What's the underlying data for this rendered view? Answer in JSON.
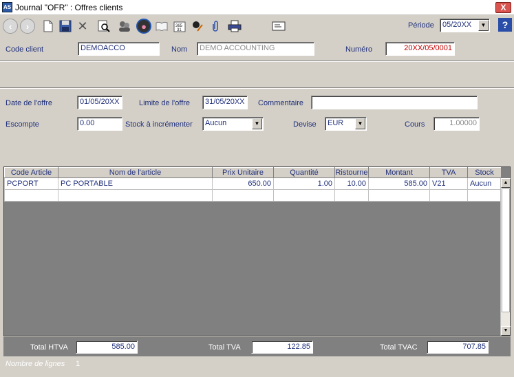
{
  "window": {
    "app_icon": "AS",
    "title": "Journal \"OFR\" : Offres clients",
    "close_label": "X"
  },
  "toolbar": {
    "periode_label": "Période",
    "periode_value": "05/20XX",
    "help_label": "?",
    "icons": [
      "back-icon",
      "forward-icon",
      "new-document-icon",
      "save-icon",
      "delete-icon",
      "search-document-icon",
      "users-icon",
      "person-icon",
      "book-icon",
      "calendar-icon",
      "edit-icon",
      "attachment-icon",
      "print-icon",
      "envelope-icon"
    ]
  },
  "header": {
    "code_client_label": "Code client",
    "code_client_value": "DEMOACCO",
    "nom_label": "Nom",
    "nom_value": "DEMO ACCOUNTING",
    "numero_label": "Numéro",
    "numero_value": "20XX/05/0001"
  },
  "details": {
    "date_label": "Date de l'offre",
    "date_value": "01/05/20XX",
    "limite_label": "Limite de l'offre",
    "limite_value": "31/05/20XX",
    "commentaire_label": "Commentaire",
    "commentaire_value": "",
    "escompte_label": "Escompte",
    "escompte_value": "0.00",
    "stock_label": "Stock à incrémenter",
    "stock_value": "Aucun",
    "devise_label": "Devise",
    "devise_value": "EUR",
    "cours_label": "Cours",
    "cours_value": "1.00000"
  },
  "grid": {
    "columns": [
      "Code Article",
      "Nom de l'article",
      "Prix Unitaire",
      "Quantité",
      "Ristourne",
      "Montant",
      "TVA",
      "Stock"
    ],
    "rows": [
      [
        "PCPORT",
        "PC PORTABLE",
        "650.00",
        "1.00",
        "10.00",
        "585.00",
        "V21",
        "Aucun"
      ],
      [
        "",
        "",
        "",
        "",
        "",
        "",
        "",
        ""
      ]
    ]
  },
  "totals": {
    "htva_label": "Total HTVA",
    "htva_value": "585.00",
    "tva_label": "Total TVA",
    "tva_value": "122.85",
    "tvac_label": "Total TVAC",
    "tvac_value": "707.85"
  },
  "footer": {
    "lines_label": "Nombre de lignes",
    "lines_value": "1"
  }
}
